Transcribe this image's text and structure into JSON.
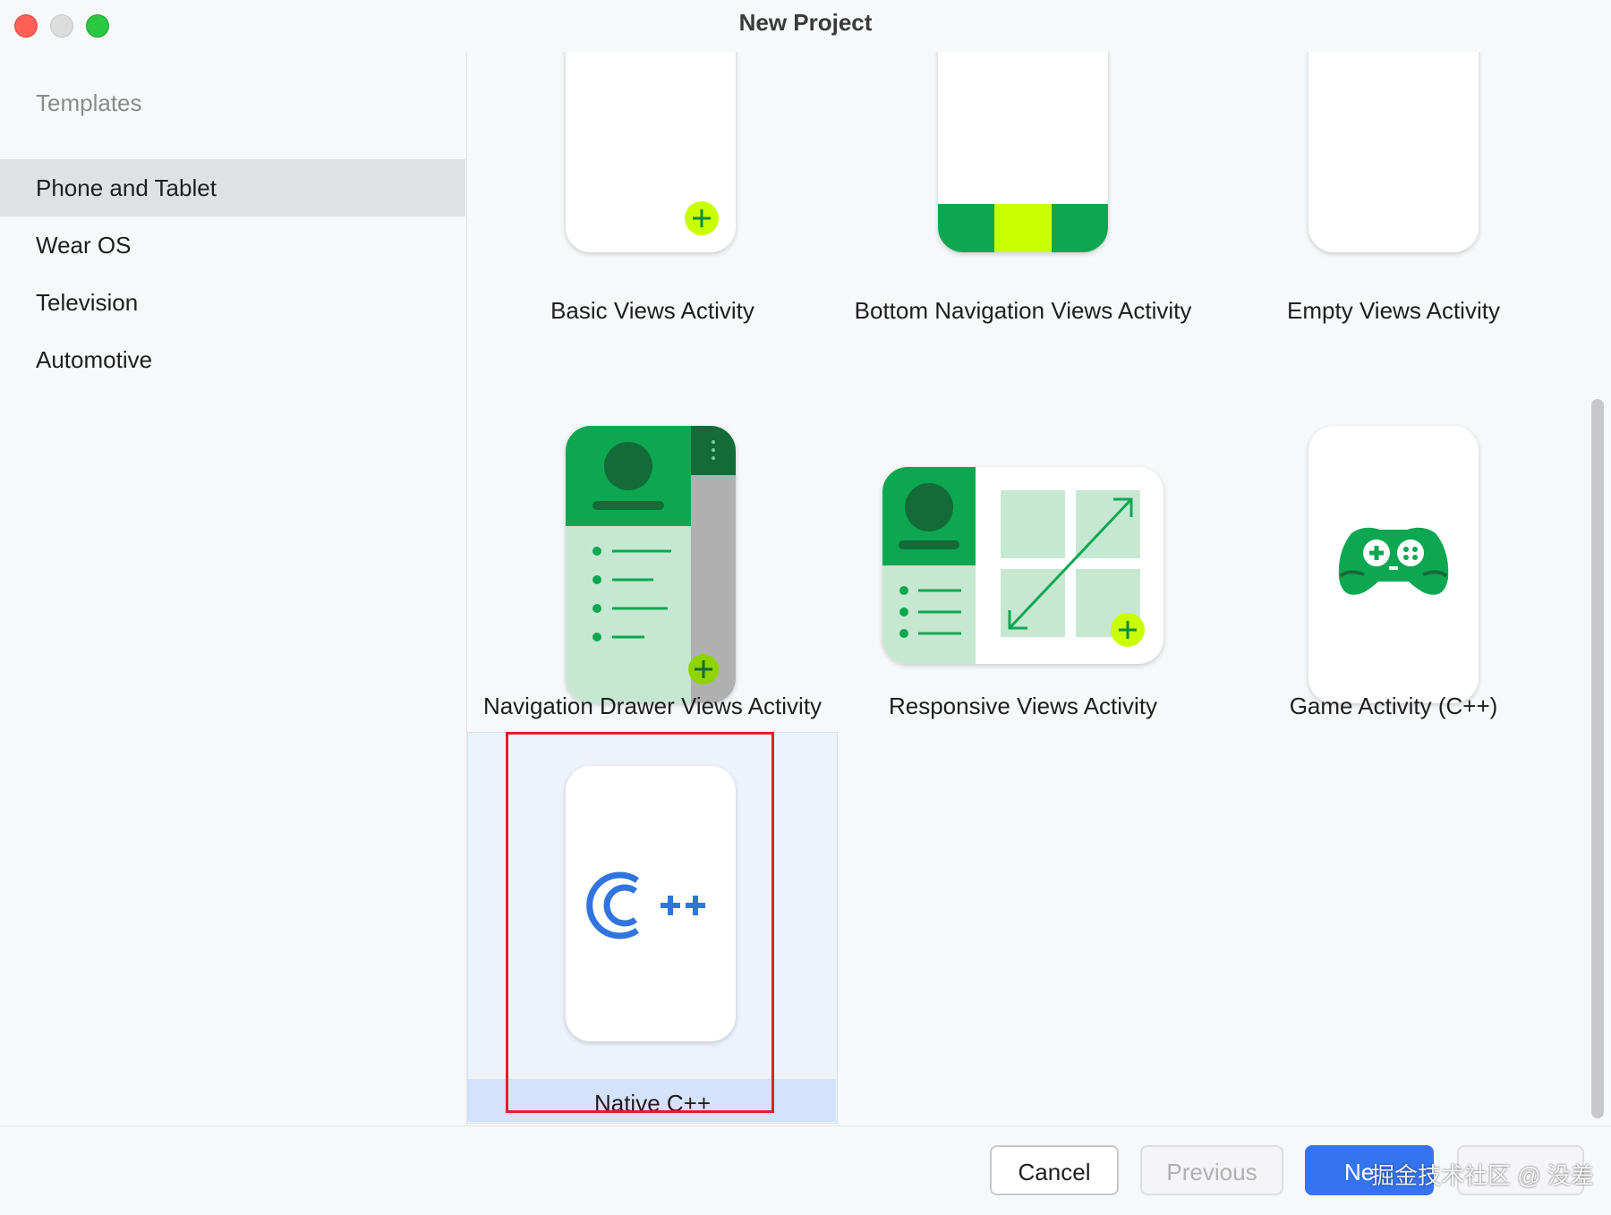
{
  "window": {
    "title": "New Project"
  },
  "sidebar": {
    "header": "Templates",
    "items": [
      {
        "label": "Phone and Tablet",
        "selected": true
      },
      {
        "label": "Wear OS",
        "selected": false
      },
      {
        "label": "Television",
        "selected": false
      },
      {
        "label": "Automotive",
        "selected": false
      }
    ]
  },
  "templates": [
    {
      "label": "Basic Views Activity",
      "icon": "basic-views-icon"
    },
    {
      "label": "Bottom Navigation Views Activity",
      "icon": "bottom-navigation-icon"
    },
    {
      "label": "Empty Views Activity",
      "icon": "empty-phone-icon"
    },
    {
      "label": "Navigation Drawer Views Activity",
      "icon": "navigation-drawer-icon"
    },
    {
      "label": "Responsive Views Activity",
      "icon": "responsive-views-icon"
    },
    {
      "label": "Game Activity (C++)",
      "icon": "gamepad-icon"
    },
    {
      "label": "Native C++",
      "icon": "cplusplus-logo-icon",
      "selected": true
    }
  ],
  "footer": {
    "cancel": "Cancel",
    "previous": "Previous",
    "next": "Ne"
  },
  "watermark": "掘金技术社区 @ 没差",
  "colors": {
    "accent": "#3574f0",
    "android_green": "#0ca750",
    "light_green": "#c6e8d2",
    "lime": "#c9ff00",
    "highlight_box": "#e0202a"
  }
}
